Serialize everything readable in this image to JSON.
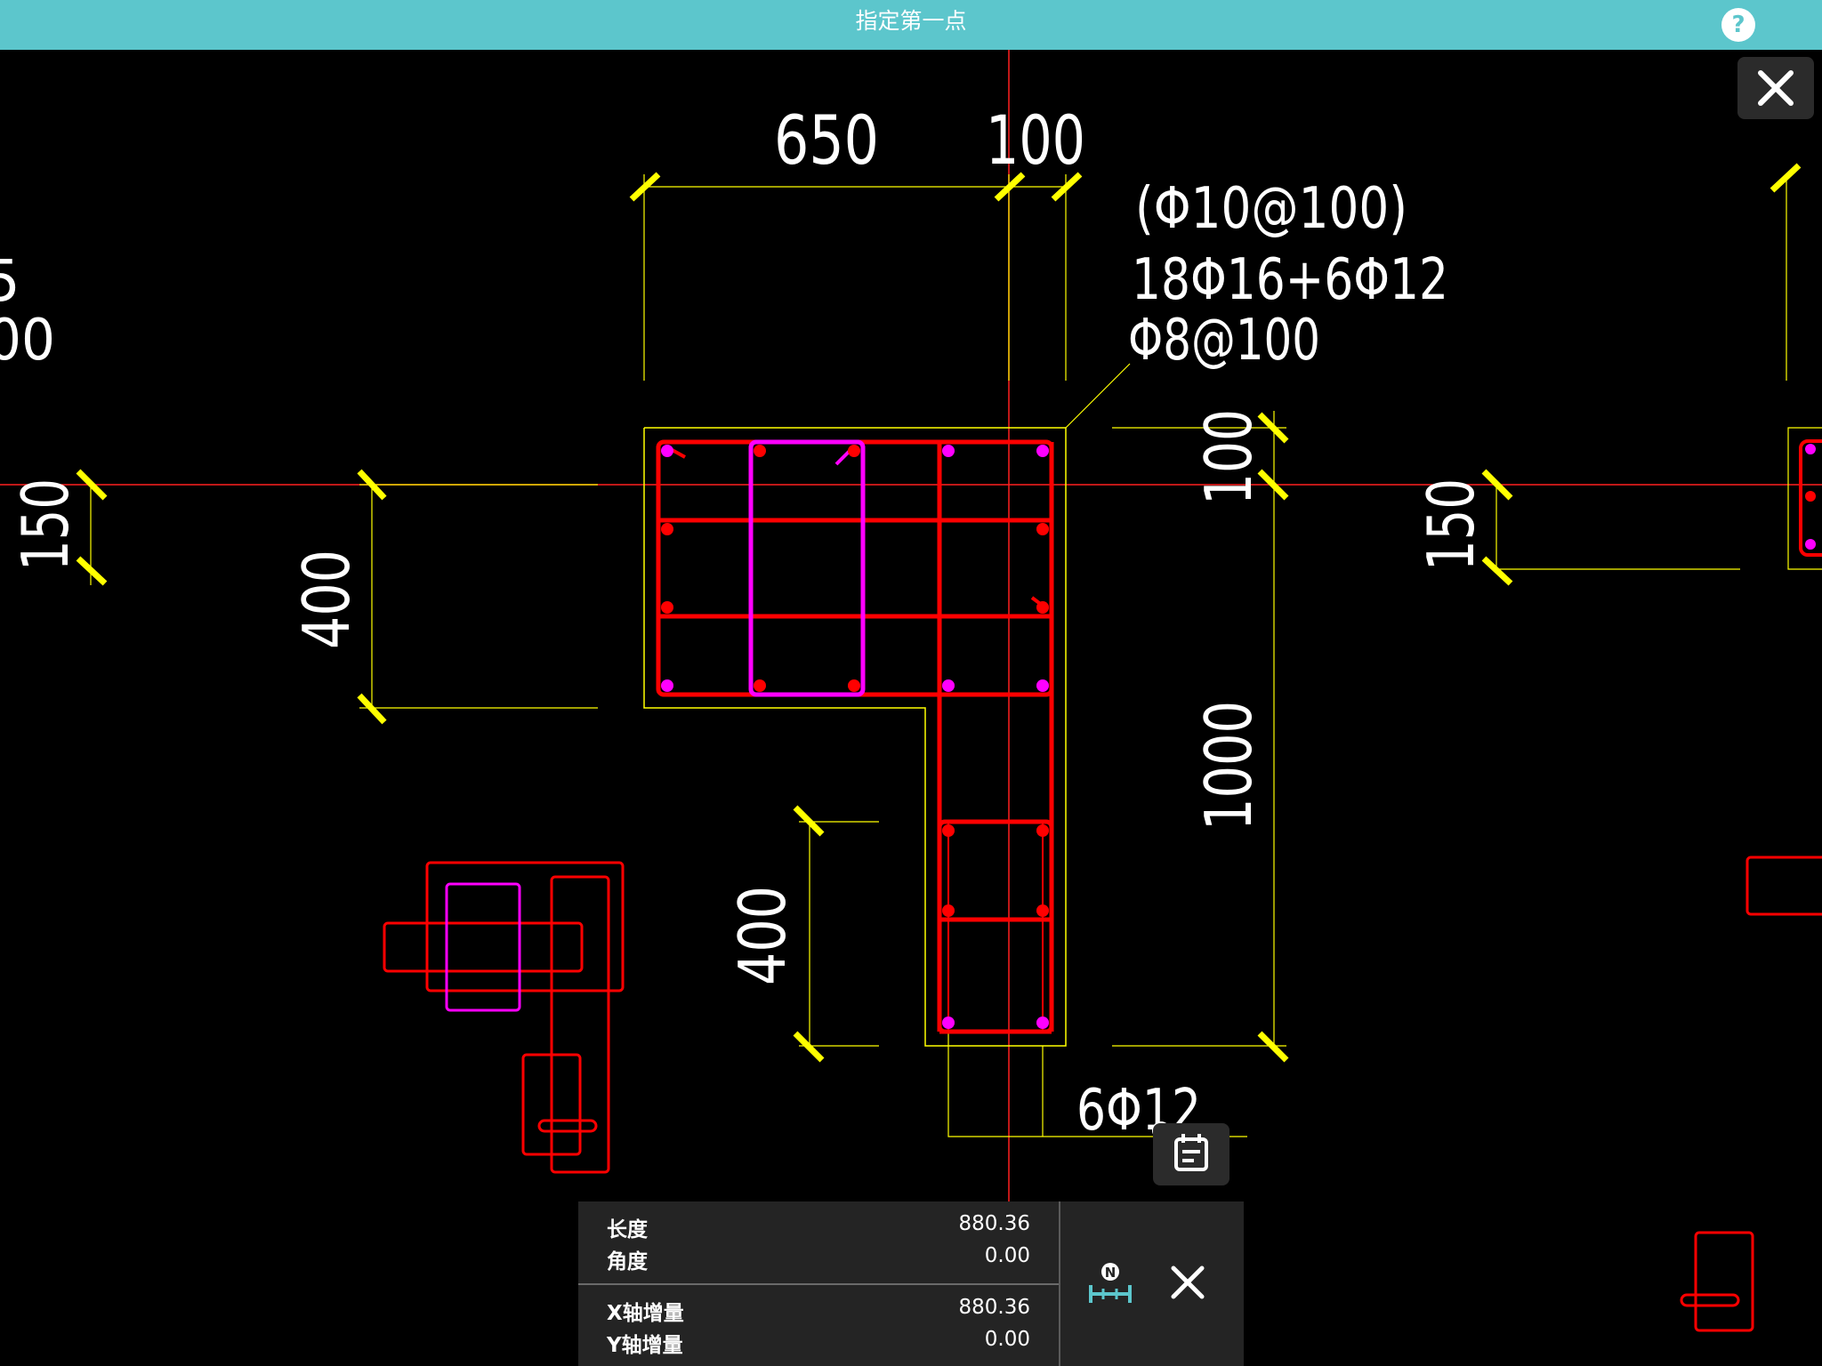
{
  "header": {
    "title": "指定第一点",
    "help_label": "?"
  },
  "toolbar": {
    "close_label": "close"
  },
  "drawing": {
    "dimensions": {
      "d650": "650",
      "d100_top": "100",
      "d400_left": "400",
      "d400_bottom": "400",
      "d100_right": "100",
      "d1000": "1000",
      "d150_left": "150",
      "d150_right": "150",
      "left_partial_a": "5",
      "left_partial_b": "00"
    },
    "annotations": {
      "stirrup_outer": "(Φ10@100)",
      "main_rebar": "18Φ16+6Φ12",
      "stirrup_inner": "Φ8@100",
      "bottom_rebar": "6Φ12"
    },
    "colors": {
      "rebar": "#ff0000",
      "tie": "#ff00ff",
      "outline": "#ffff00",
      "axis": "#ff2020",
      "tick": "#ffff00"
    }
  },
  "measure_panel": {
    "length_label": "长度",
    "length_value": "880.36",
    "angle_label": "角度",
    "angle_value": "0.00",
    "dx_label": "X轴增量",
    "dx_value": "880.36",
    "dy_label": "Y轴增量",
    "dy_value": "0.00",
    "north_icon": "north-ruler-icon",
    "close_icon": "close-icon"
  }
}
